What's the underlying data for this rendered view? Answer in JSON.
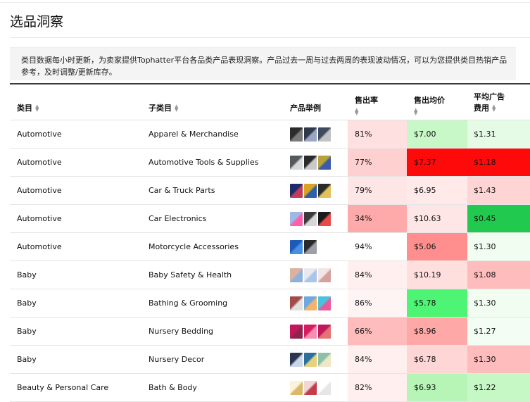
{
  "page": {
    "title": "选品洞察",
    "notice": "类目数据每小时更新，为卖家提供Tophatter平台各品类产品表现洞察。产品过去一周与过去两周的表现波动情况，可以为您提供类目热销产品参考，及时调整/更新库存。"
  },
  "table": {
    "headers": {
      "category": "类目",
      "subcategory": "子类目",
      "examples": "产品举例",
      "sell_rate": "售出率",
      "avg_price": "售出均价",
      "ad_cost_line1": "平均广告",
      "ad_cost_line2": "费用"
    },
    "rows": [
      {
        "category": "Automotive",
        "subcategory": "Apparel & Merchandise",
        "sell_rate": "81%",
        "avg_price": "$7.00",
        "ad_cost": "$1.31",
        "sell_color": "#ffe0e0",
        "price_color": "#c8f7c8",
        "ad_color": "#e6fbe6",
        "thumbs": [
          [
            "#2b2b2b",
            "#7a7a7a"
          ],
          [
            "#31384a",
            "#9aa6c4"
          ],
          [
            "#3d4c5c",
            "#c2c2c2"
          ]
        ]
      },
      {
        "category": "Automotive",
        "subcategory": "Automotive Tools & Supplies",
        "sell_rate": "77%",
        "avg_price": "$7.37",
        "ad_cost": "$1.18",
        "sell_color": "#ffd0d0",
        "price_color": "#ff0a0a",
        "ad_color": "#ff0a0a",
        "thumbs": [
          [
            "#55595e",
            "#d8d8d8"
          ],
          [
            "#2a2a2a",
            "#c9c9c9"
          ],
          [
            "#b7a13a",
            "#3a5ca8"
          ]
        ]
      },
      {
        "category": "Automotive",
        "subcategory": "Car & Truck Parts",
        "sell_rate": "79%",
        "avg_price": "$6.95",
        "ad_cost": "$1.43",
        "sell_color": "#ffe6e6",
        "price_color": "#ffe9e9",
        "ad_color": "#ffd4d4",
        "thumbs": [
          [
            "#1f2a6b",
            "#c23b5a"
          ],
          [
            "#d9a520",
            "#2e5fa8"
          ],
          [
            "#2a2a2a",
            "#e0c25a"
          ]
        ]
      },
      {
        "category": "Automotive",
        "subcategory": "Car Electronics",
        "sell_rate": "34%",
        "avg_price": "$10.63",
        "ad_cost": "$0.45",
        "sell_color": "#ffaaaa",
        "price_color": "#ffe6e6",
        "ad_color": "#22c94f",
        "thumbs": [
          [
            "#9fb8e6",
            "#ff5fa8"
          ],
          [
            "#3a3a3a",
            "#d6d6d6"
          ],
          [
            "#1a1a1a",
            "#e84a4a"
          ]
        ]
      },
      {
        "category": "Automotive",
        "subcategory": "Motorcycle Accessories",
        "sell_rate": "94%",
        "avg_price": "$5.06",
        "ad_cost": "$1.30",
        "sell_color": "#ffffff",
        "price_color": "#ff8f8f",
        "ad_color": "#f1fdf1",
        "thumbs": [
          [
            "#1e5bb8",
            "#4a90e2"
          ],
          [
            "#2a2a2a",
            "#9aa0a6"
          ]
        ]
      },
      {
        "category": "Baby",
        "subcategory": "Baby Safety & Health",
        "sell_rate": "84%",
        "avg_price": "$10.19",
        "ad_cost": "$1.08",
        "sell_color": "#ffefef",
        "price_color": "#ffdede",
        "ad_color": "#ffbcbc",
        "thumbs": [
          [
            "#d9b3a0",
            "#8fb0d9"
          ],
          [
            "#e9e9f0",
            "#a9c6e8"
          ],
          [
            "#f2e6e6",
            "#d7a0a0"
          ]
        ]
      },
      {
        "category": "Baby",
        "subcategory": "Bathing & Grooming",
        "sell_rate": "86%",
        "avg_price": "$5.78",
        "ad_cost": "$1.30",
        "sell_color": "#fff4f4",
        "price_color": "#4ef574",
        "ad_color": "#f1fdf1",
        "thumbs": [
          [
            "#a54a4a",
            "#e0e0e0"
          ],
          [
            "#6fa8dc",
            "#f6b26b"
          ],
          [
            "#49c2e0",
            "#e85a9a"
          ]
        ]
      },
      {
        "category": "Baby",
        "subcategory": "Nursery Bedding",
        "sell_rate": "66%",
        "avg_price": "$8.96",
        "ad_cost": "$1.27",
        "sell_color": "#ffbcbc",
        "price_color": "#ffa8a8",
        "ad_color": "#f4fdf4",
        "thumbs": [
          [
            "#c2185b",
            "#8e244d"
          ],
          [
            "#d81b60",
            "#f48fb1"
          ],
          [
            "#c2185b",
            "#e57373"
          ]
        ]
      },
      {
        "category": "Baby",
        "subcategory": "Nursery Decor",
        "sell_rate": "84%",
        "avg_price": "$6.78",
        "ad_cost": "$1.30",
        "sell_color": "#ffefef",
        "price_color": "#ffd6d6",
        "ad_color": "#ffbcbc",
        "thumbs": [
          [
            "#2a3550",
            "#c9d6e8"
          ],
          [
            "#2b6f9e",
            "#e6d27a"
          ],
          [
            "#8cc0a8",
            "#f0e6c8"
          ]
        ]
      },
      {
        "category": "Beauty & Personal Care",
        "subcategory": "Bath & Body",
        "sell_rate": "82%",
        "avg_price": "$6.93",
        "ad_cost": "$1.22",
        "sell_color": "#ffefef",
        "price_color": "#b6f5b6",
        "ad_color": "#c6f8c6",
        "thumbs": [
          [
            "#fbf3d9",
            "#d9b86a"
          ],
          [
            "#f3d6d6",
            "#c43c4a"
          ],
          [
            "#ffffff",
            "#e6e6e6"
          ]
        ]
      }
    ]
  },
  "icons": {
    "sort": "sort-icon",
    "product_thumbnail": "product-thumbnail-icon"
  }
}
